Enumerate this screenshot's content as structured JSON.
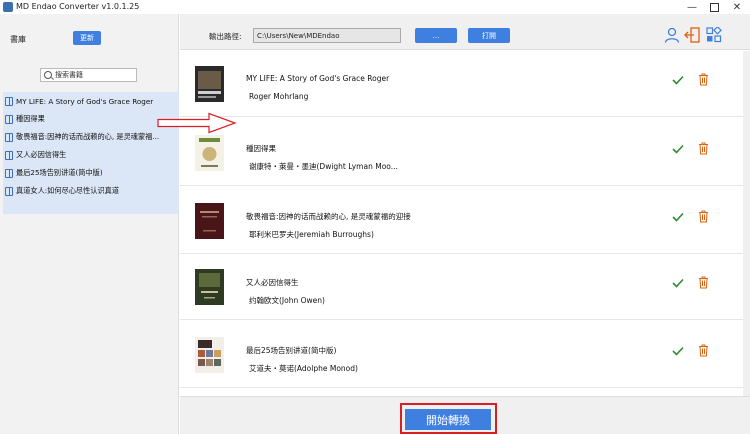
{
  "window": {
    "title": "MD Endao Converter v1.0.1.25"
  },
  "sidebar": {
    "label": "書庫",
    "refresh_label": "更新",
    "search_placeholder": "搜索書籍",
    "items": [
      "MY LIFE: A Story of God's Grace Roger",
      "種因得果",
      "敬畏福音:因神的话而战赖的心, 是灵魂蒙福...",
      "又人必因信得生",
      "最后25场告别讲道(简中版)",
      "真道女人:如何尽心尽性认识真道"
    ]
  },
  "toolbar": {
    "output_label": "輸出路徑:",
    "output_path": "C:\\Users\\New\\MDEndao",
    "browse_label": "...",
    "open_label": "打開"
  },
  "books": [
    {
      "title": "MY LIFE: A Story of God's Grace Roger",
      "author": "Roger Mohrlang"
    },
    {
      "title": "種因得果",
      "author": "谢康特・萊曼・墨迪(Dwight Lyman Moo..."
    },
    {
      "title": "敬畏福音:因神的话而战赖的心, 是灵魂蒙福的迎接",
      "author": "耶利米巴罗夫(Jeremiah Burroughs)"
    },
    {
      "title": "又人必因信得生",
      "author": "约翰欧文(John Owen)"
    },
    {
      "title": "最后25场告别讲道(简中版)",
      "author": "艾道夫・莫诺(Adolphe Monod)"
    }
  ],
  "footer": {
    "start_label": "開始轉換"
  },
  "colors": {
    "accent": "#3f7fe0",
    "check": "#2e8b2e",
    "trash": "#e06010",
    "highlight": "#d81f26",
    "list_selected": "#dbe7f7"
  }
}
